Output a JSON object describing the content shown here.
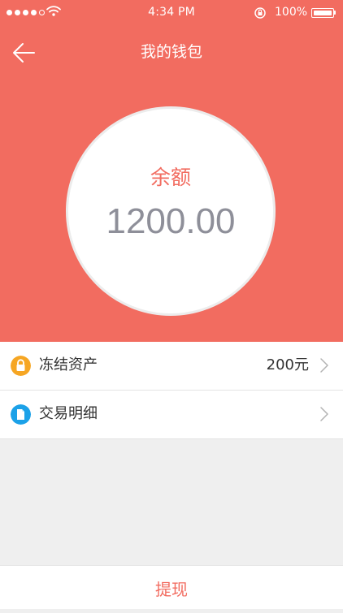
{
  "status_bar": {
    "time": "4:34 PM",
    "battery": "100%"
  },
  "header": {
    "title": "我的钱包"
  },
  "balance": {
    "label": "余额",
    "amount": "1200.00"
  },
  "list": [
    {
      "label": "冻结资产",
      "value": "200元",
      "icon": "lock-icon",
      "icon_color": "#f6a623"
    },
    {
      "label": "交易明细",
      "icon": "document-icon",
      "icon_color": "#1ba1e8"
    }
  ],
  "bottom": {
    "withdraw": "提现"
  },
  "colors": {
    "accent": "#f26c60",
    "background": "#efefef",
    "text_dark": "#333333",
    "balance_gray": "#8e8f99"
  }
}
